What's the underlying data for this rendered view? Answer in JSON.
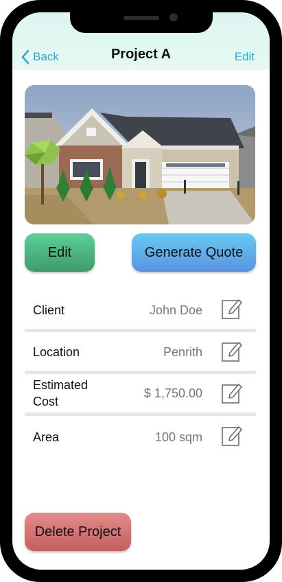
{
  "nav": {
    "back_label": "Back",
    "title": "Project A",
    "edit_label": "Edit"
  },
  "photo": {
    "icon": "house-photo"
  },
  "actions": {
    "edit_label": "Edit",
    "quote_label": "Generate Quote",
    "delete_label": "Delete Project"
  },
  "details": [
    {
      "label": "Client",
      "value": "John Doe"
    },
    {
      "label": "Location",
      "value": "Penrith"
    },
    {
      "label": "Estimated Cost",
      "value": "$ 1,750.00"
    },
    {
      "label": "Area",
      "value": "100 sqm"
    }
  ],
  "colors": {
    "accent": "#2ea6d9",
    "edit_button": "#4fb883",
    "quote_button": "#62aee9",
    "delete_button": "#d47272"
  }
}
